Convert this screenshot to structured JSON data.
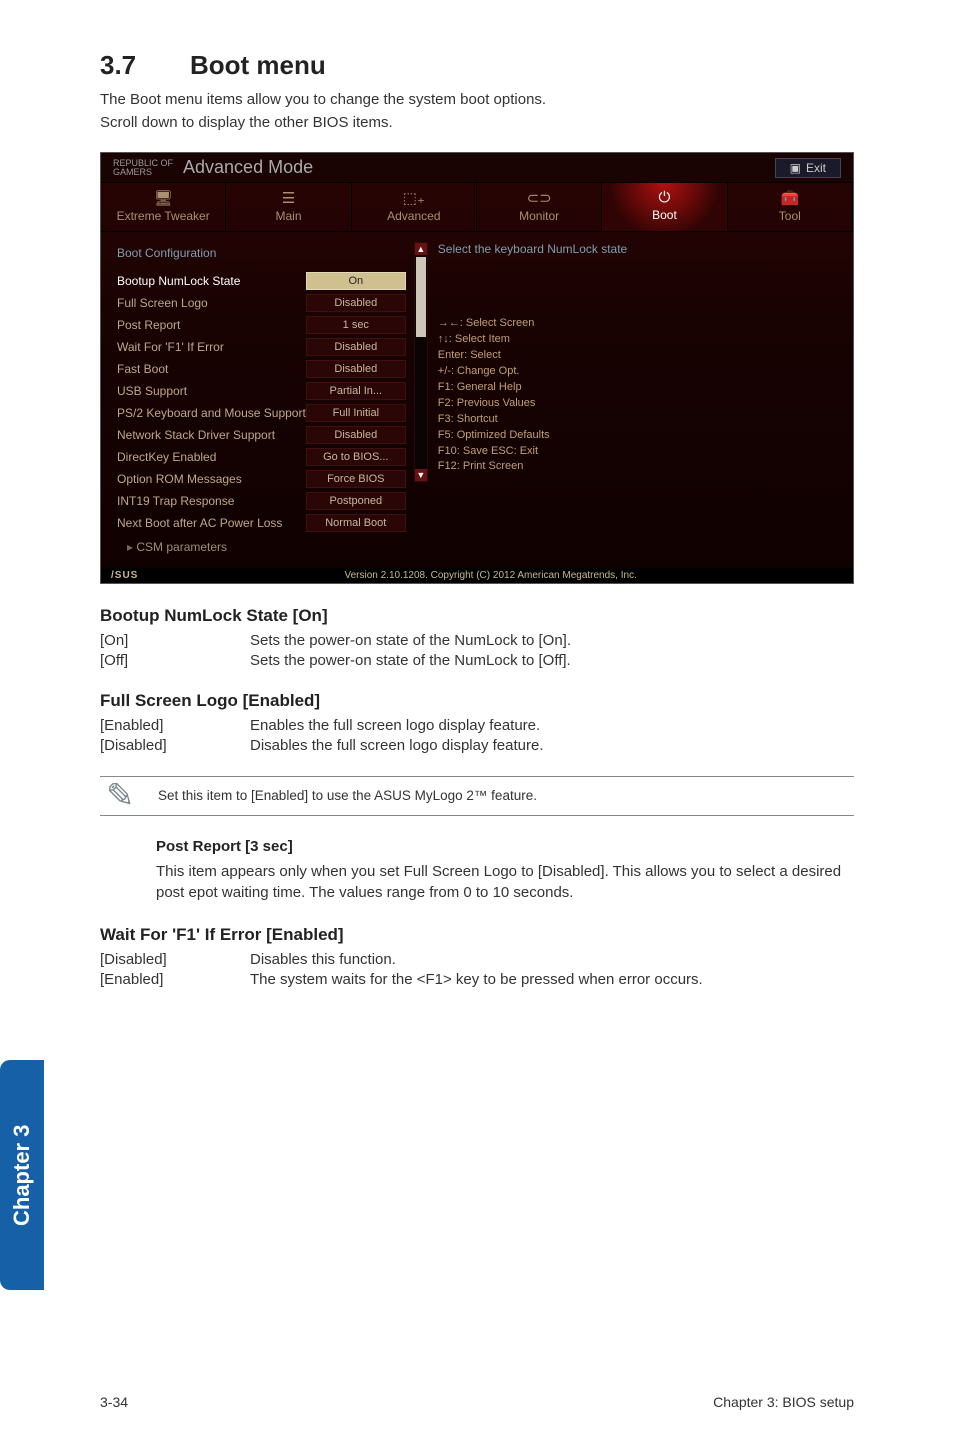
{
  "heading": {
    "number": "3.7",
    "title": "Boot menu"
  },
  "intro": [
    "The Boot menu items allow you to change the system boot options.",
    "Scroll down to display the other BIOS items."
  ],
  "bios": {
    "brand_top": "REPUBLIC OF",
    "brand_bottom": "GAMERS",
    "mode": "Advanced Mode",
    "exit": "Exit",
    "tabs": [
      {
        "label": "Extreme Tweaker"
      },
      {
        "label": "Main"
      },
      {
        "label": "Advanced"
      },
      {
        "label": "Monitor"
      },
      {
        "label": "Boot"
      },
      {
        "label": "Tool"
      }
    ],
    "section_title": "Boot Configuration",
    "rows": [
      {
        "label": "Bootup NumLock State",
        "value": "On",
        "selected": true
      },
      {
        "label": "Full Screen Logo",
        "value": "Disabled"
      },
      {
        "label": "Post Report",
        "value": "1 sec"
      },
      {
        "label": "Wait For 'F1' If Error",
        "value": "Disabled"
      },
      {
        "label": "Fast Boot",
        "value": "Disabled"
      },
      {
        "label": "USB Support",
        "value": "Partial In..."
      },
      {
        "label": "PS/2 Keyboard and Mouse Support",
        "value": "Full Initial"
      },
      {
        "label": "Network Stack Driver Support",
        "value": "Disabled"
      },
      {
        "label": "DirectKey Enabled",
        "value": "Go to BIOS..."
      },
      {
        "label": "Option ROM Messages",
        "value": "Force BIOS"
      },
      {
        "label": "INT19 Trap Response",
        "value": "Postponed"
      },
      {
        "label": "Next Boot after AC Power Loss",
        "value": "Normal Boot"
      }
    ],
    "sub": "CSM parameters",
    "help_title": "Select the keyboard NumLock state",
    "help_keys": [
      "→←: Select Screen",
      "↑↓: Select Item",
      "Enter: Select",
      "+/-: Change Opt.",
      "F1: General Help",
      "F2: Previous Values",
      "F3: Shortcut",
      "F5: Optimized Defaults",
      "F10: Save  ESC: Exit",
      "F12: Print Screen"
    ],
    "footer_brand": "/SUS",
    "footer_text": "Version 2.10.1208. Copyright (C) 2012 American Megatrends, Inc."
  },
  "sections": {
    "numlock": {
      "title": "Bootup NumLock State [On]",
      "opts": [
        {
          "key": "[On]",
          "desc": "Sets the power-on state of the NumLock to [On]."
        },
        {
          "key": "[Off]",
          "desc": "Sets the power-on state of the NumLock to [Off]."
        }
      ]
    },
    "logo": {
      "title": "Full Screen Logo [Enabled]",
      "opts": [
        {
          "key": "[Enabled]",
          "desc": "Enables the full screen logo display feature."
        },
        {
          "key": "[Disabled]",
          "desc": "Disables the full screen logo display feature."
        }
      ]
    },
    "note": "Set this item to [Enabled] to use the ASUS MyLogo 2™ feature.",
    "post_report": {
      "title": "Post Report [3 sec]",
      "body": "This item appears only when you set Full Screen Logo to [Disabled]. This allows you to select a desired post epot waiting time. The values range from 0 to 10 seconds."
    },
    "wait_f1": {
      "title": "Wait For 'F1' If Error [Enabled]",
      "opts": [
        {
          "key": "[Disabled]",
          "desc": "Disables this function."
        },
        {
          "key": "[Enabled]",
          "desc": "The system waits for the <F1> key to be pressed when error occurs."
        }
      ]
    }
  },
  "side_tab": "Chapter 3",
  "footer": {
    "left": "3-34",
    "right": "Chapter 3: BIOS setup"
  }
}
